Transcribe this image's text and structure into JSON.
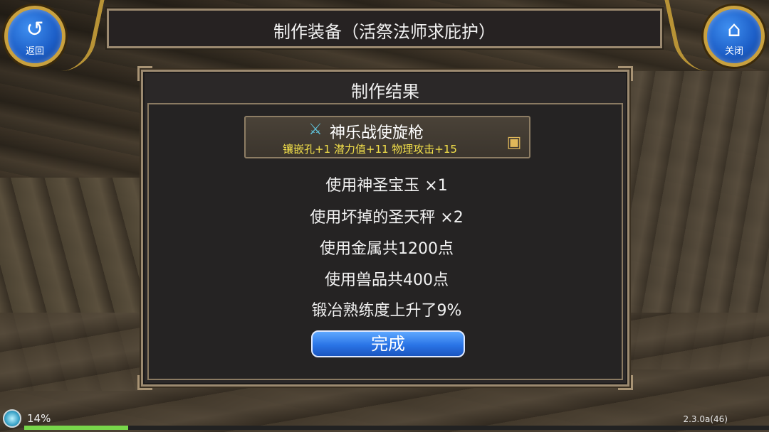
{
  "nav": {
    "back_label": "返回",
    "back_icon": "return-arrow-icon",
    "close_label": "关闭",
    "close_icon": "home-icon"
  },
  "header": {
    "title": "制作装备（活祭法师求庇护）"
  },
  "panel": {
    "title": "制作结果",
    "item": {
      "name": "神乐战使旋枪",
      "icon": "spear-icon",
      "stats": "镶嵌孔+1 潜力值+11 物理攻击+15",
      "stats_color": "#f3e04a",
      "chest_icon": "treasure-chest-icon"
    },
    "results": [
      "使用神圣宝玉 ×1",
      "使用坏掉的圣天秤 ×2",
      "使用金属共1200点",
      "使用兽品共400点",
      "锻冶熟练度上升了9%"
    ],
    "done_label": "完成"
  },
  "status": {
    "percent_text": "14%",
    "progress": 0.14,
    "version": "2.3.0a(46)"
  }
}
